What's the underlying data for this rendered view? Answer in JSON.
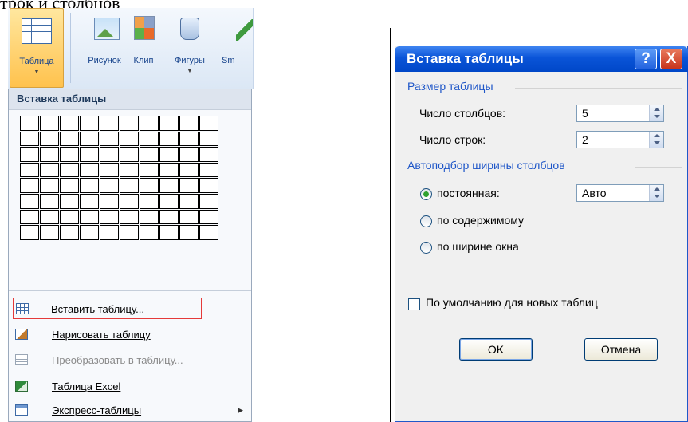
{
  "caption": "трок и столбцов",
  "ribbon": {
    "table_label": "Таблица",
    "picture_label": "Рисунок",
    "clip_label": "Клип",
    "shapes_label": "Фигуры",
    "smartart_label": "Sm"
  },
  "menu": {
    "header": "Вставка таблицы",
    "grid": {
      "columns": 10,
      "rows": 8
    },
    "items": [
      {
        "label": "Вставить таблицу...",
        "icon": "table-icon",
        "highlighted": true
      },
      {
        "label": "Нарисовать таблицу",
        "icon": "draw-table-icon"
      },
      {
        "label": "Преобразовать в таблицу...",
        "icon": "convert-icon",
        "disabled": true
      },
      {
        "label": "Таблица Excel",
        "icon": "excel-icon"
      },
      {
        "label": "Экспресс-таблицы",
        "icon": "quick-tables-icon",
        "submenu": true
      }
    ]
  },
  "dialog": {
    "title": "Вставка таблицы",
    "help_button": "?",
    "close_button": "X",
    "size_group": "Размер таблицы",
    "columns_label": "Число столбцов:",
    "columns_value": "5",
    "rows_label": "Число строк:",
    "rows_value": "2",
    "autofit_group": "Автоподбор ширины столбцов",
    "fixed_label": "постоянная:",
    "fixed_value": "Авто",
    "content_label": "по содержимому",
    "window_label": "по ширине окна",
    "default_label": "По умолчанию для новых таблиц",
    "ok_label": "OK",
    "cancel_label": "Отмена"
  },
  "colors": {
    "accent": "#1e56c8",
    "title_bar": "#0a54d8",
    "highlight": "#e53a3a"
  }
}
